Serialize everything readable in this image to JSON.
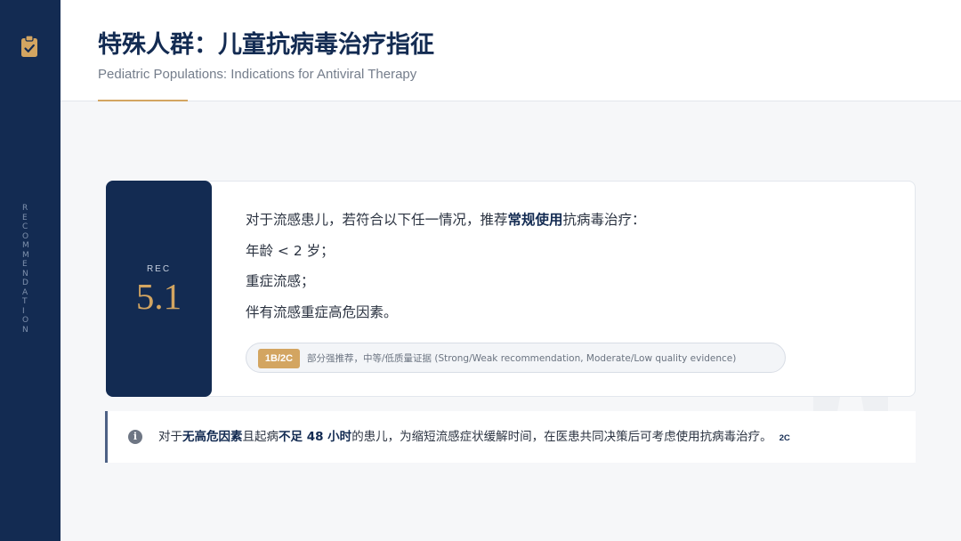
{
  "sidebar": {
    "icon": "clipboard-check-icon",
    "vertical_label": [
      "R",
      "E",
      "C",
      "O",
      "M",
      "M",
      "E",
      "N",
      "D",
      "A",
      "T",
      "I",
      "O",
      "N"
    ]
  },
  "header": {
    "title": "特殊人群：儿童抗病毒治疗指征",
    "subtitle": "Pediatric Populations: Indications for Antiviral Therapy"
  },
  "rec": {
    "label": "REC",
    "number": "5.1",
    "intro_before": "对于流感患儿，若符合以下任一情况，推荐",
    "intro_bold": "常规使用",
    "intro_after": "抗病毒治疗：",
    "conditions": [
      "年龄 < 2 岁；",
      "重症流感；",
      "伴有流感重症高危因素。"
    ],
    "grade": "1B/2C",
    "grade_text": "部分强推荐，中等/低质量证据 (Strong/Weak recommendation, Moderate/Low quality evidence)"
  },
  "note": {
    "icon": "info-icon",
    "p1": "对于",
    "b1": "无高危因素",
    "p2": "且起病",
    "b2": "不足 48 小时",
    "p3": "的患儿，为缩短流感症状缓解时间，在医患共同决策后可考虑使用抗病毒治疗。",
    "grade": "2C"
  },
  "colors": {
    "navy": "#132b52",
    "gold": "#d3a561",
    "background": "#f6f7f9"
  }
}
